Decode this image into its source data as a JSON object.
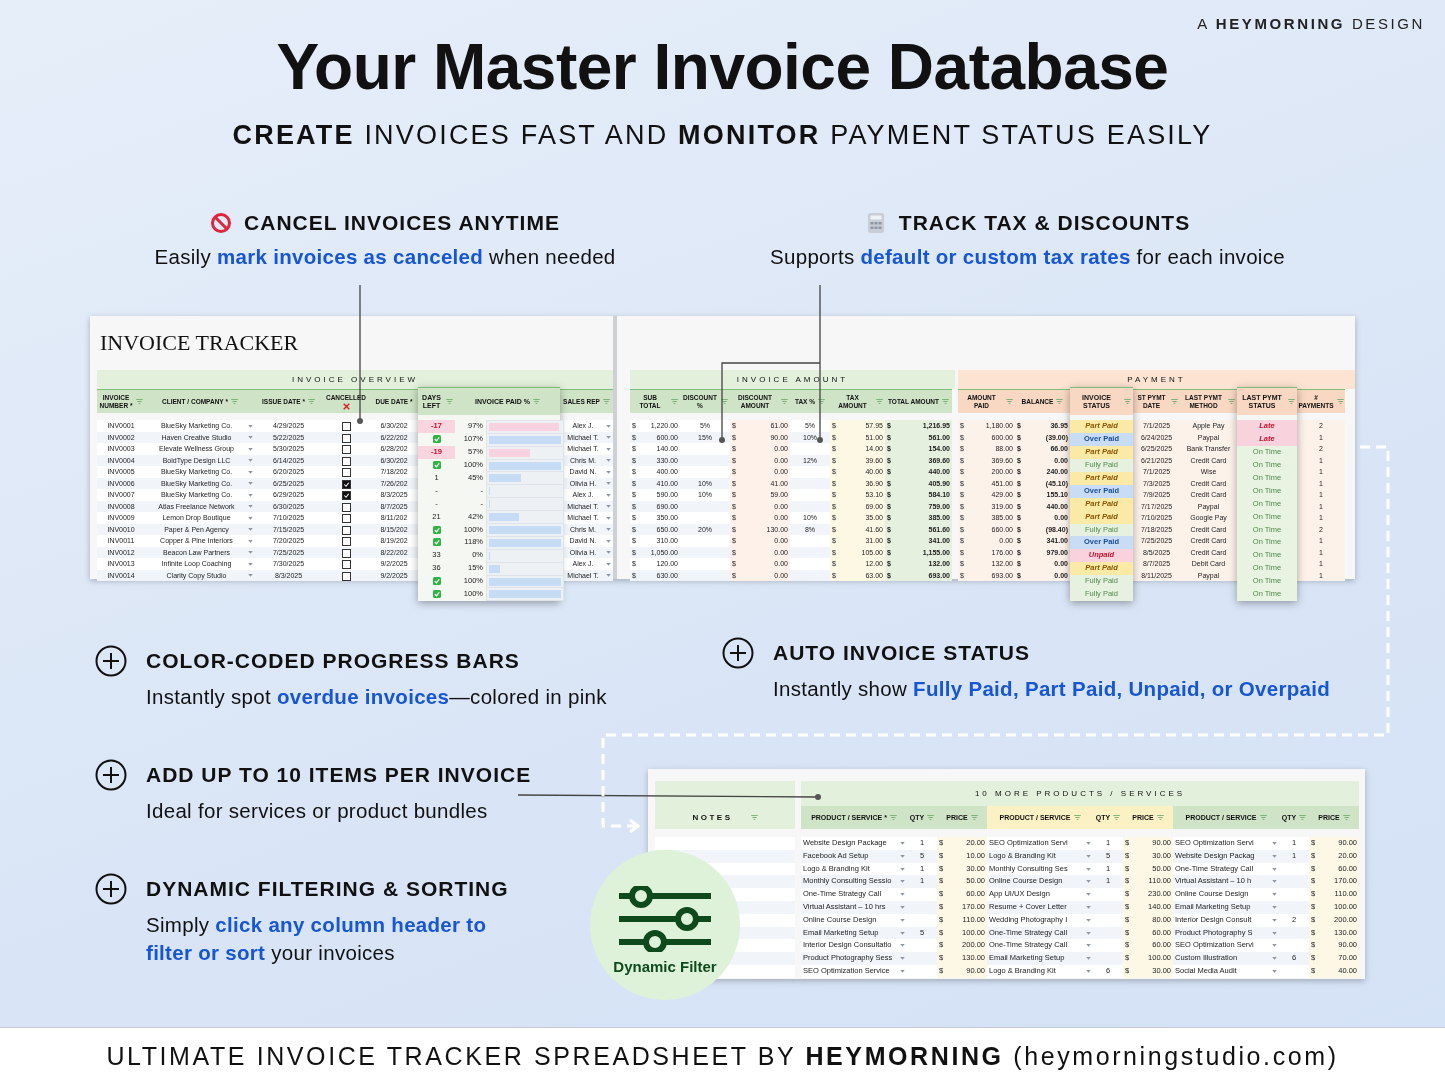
{
  "brand": "A **HEYMORNING** DESIGN",
  "title": "Your Master Invoice Database",
  "subtitle": "**CREATE** INVOICES FAST AND **MONITOR** PAYMENT STATUS EASILY",
  "top_features": [
    {
      "heading": "CANCEL INVOICES ANYTIME",
      "text": "Easily **mark invoices as canceled** when needed"
    },
    {
      "heading": "TRACK TAX & DISCOUNTS",
      "text": "Supports **default or custom tax rates** for each invoice"
    }
  ],
  "sheet_title": "INVOICE TRACKER",
  "overview": {
    "label": "INVOICE OVERVIEW",
    "headers": [
      "INVOICE NUMBER *",
      "CLIENT / COMPANY *",
      "ISSUE DATE *",
      "CANCELLED",
      "DUE DATE *",
      "DAYS LEFT",
      "INVOICE PAID %",
      "SALES REP"
    ],
    "rows": [
      {
        "number": "INV0001",
        "client": "BlueSky Marketing Co.",
        "issue_date": "4/29/2025",
        "cancelled": false,
        "due_date": "6/30/202",
        "days": {
          "kind": "overdue",
          "text": "-17"
        },
        "paid": "97%",
        "level": 0.97,
        "sales_rep": "Alex J."
      },
      {
        "number": "INV0002",
        "client": "Haven Creative Studio",
        "issue_date": "5/22/2025",
        "cancelled": false,
        "due_date": "6/22/202",
        "days": {
          "kind": "paid"
        },
        "paid": "107%",
        "level": 1,
        "sales_rep": "Michael T."
      },
      {
        "number": "INV0003",
        "client": "Elevate Wellness Group",
        "issue_date": "5/30/2025",
        "cancelled": false,
        "due_date": "6/28/202",
        "days": {
          "kind": "overdue",
          "text": "-19"
        },
        "paid": "57%",
        "level": 0.57,
        "sales_rep": "Michael T."
      },
      {
        "number": "INV0004",
        "client": "BoldType Design LLC",
        "issue_date": "6/14/2025",
        "cancelled": false,
        "due_date": "6/30/202",
        "days": {
          "kind": "paid"
        },
        "paid": "100%",
        "level": 1,
        "sales_rep": "Chris M."
      },
      {
        "number": "INV0005",
        "client": "BlueSky Marketing Co.",
        "issue_date": "6/20/2025",
        "cancelled": false,
        "due_date": "7/18/202",
        "days": {
          "kind": "plain",
          "text": "1"
        },
        "paid": "45%",
        "level": 0.45,
        "sales_rep": "David N."
      },
      {
        "number": "INV0006",
        "client": "BlueSky Marketing Co.",
        "issue_date": "6/25/2025",
        "cancelled": true,
        "due_date": "7/26/202",
        "days": {
          "kind": "plain",
          "text": "-"
        },
        "paid": "-",
        "level": 0,
        "sales_rep": "Olivia H."
      },
      {
        "number": "INV0007",
        "client": "BlueSky Marketing Co.",
        "issue_date": "6/29/2025",
        "cancelled": true,
        "due_date": "8/3/2025",
        "days": {
          "kind": "plain",
          "text": "-"
        },
        "paid": "-",
        "level": 0,
        "sales_rep": "Alex J."
      },
      {
        "number": "INV0008",
        "client": "Atlas Freelance Network",
        "issue_date": "6/30/2025",
        "cancelled": false,
        "due_date": "8/7/2025",
        "days": {
          "kind": "plain",
          "text": "21"
        },
        "paid": "42%",
        "level": 0.42,
        "sales_rep": "Michael T."
      },
      {
        "number": "INV0009",
        "client": "Lemon Drop Boutique",
        "issue_date": "7/10/2025",
        "cancelled": false,
        "due_date": "8/11/202",
        "days": {
          "kind": "paid"
        },
        "paid": "100%",
        "level": 1,
        "sales_rep": "Michael T."
      },
      {
        "number": "INV0010",
        "client": "Paper & Pen Agency",
        "issue_date": "7/15/2025",
        "cancelled": false,
        "due_date": "8/15/202",
        "days": {
          "kind": "paid"
        },
        "paid": "118%",
        "level": 1,
        "sales_rep": "Chris M."
      },
      {
        "number": "INV0011",
        "client": "Copper & Pine Interiors",
        "issue_date": "7/20/2025",
        "cancelled": false,
        "due_date": "8/19/202",
        "days": {
          "kind": "plain",
          "text": "33"
        },
        "paid": "0%",
        "level": 0,
        "sales_rep": "David N."
      },
      {
        "number": "INV0012",
        "client": "Beacon Law Partners",
        "issue_date": "7/25/2025",
        "cancelled": false,
        "due_date": "8/22/202",
        "days": {
          "kind": "plain",
          "text": "36"
        },
        "paid": "15%",
        "level": 0.15,
        "sales_rep": "Olivia H."
      },
      {
        "number": "INV0013",
        "client": "Infinite Loop Coaching",
        "issue_date": "7/30/2025",
        "cancelled": false,
        "due_date": "9/2/2025",
        "days": {
          "kind": "paid"
        },
        "paid": "100%",
        "level": 1,
        "sales_rep": "Alex J."
      },
      {
        "number": "INV0014",
        "client": "Clarity Copy Studio",
        "issue_date": "8/3/2025",
        "cancelled": false,
        "due_date": "9/2/2025",
        "days": {
          "kind": "paid"
        },
        "paid": "100%",
        "level": 1,
        "sales_rep": "Michael T."
      }
    ]
  },
  "amounts": {
    "label": "INVOICE AMOUNT",
    "headers": [
      "SUB TOTAL",
      "DISCOUNT %",
      "DISCOUNT AMOUNT",
      "TAX %",
      "TAX AMOUNT",
      "TOTAL AMOUNT"
    ],
    "rows": [
      {
        "sub_total": "$ 1,220.00",
        "discount_pct": "5%",
        "discount_amount": "$ 61.00",
        "tax_pct": "5%",
        "tax_amount": "$ 57.95",
        "total_amount": "$ 1,216.95"
      },
      {
        "sub_total": "$ 600.00",
        "discount_pct": "15%",
        "discount_amount": "$ 90.00",
        "tax_pct": "10%",
        "tax_amount": "$ 51.00",
        "total_amount": "$ 561.00"
      },
      {
        "sub_total": "$ 140.00",
        "discount_amount": "$ 0.00",
        "tax_amount": "$ 14.00",
        "total_amount": "$ 154.00"
      },
      {
        "sub_total": "$ 330.00",
        "discount_amount": "$ 0.00",
        "tax_pct": "12%",
        "tax_amount": "$ 39.60",
        "total_amount": "$ 369.60"
      },
      {
        "sub_total": "$ 400.00",
        "discount_amount": "$ 0.00",
        "tax_amount": "$ 40.00",
        "total_amount": "$ 440.00"
      },
      {
        "sub_total": "$ 410.00",
        "discount_pct": "10%",
        "discount_amount": "$ 41.00",
        "tax_amount": "$ 36.90",
        "total_amount": "$ 405.90"
      },
      {
        "sub_total": "$ 590.00",
        "discount_pct": "10%",
        "discount_amount": "$ 59.00",
        "tax_amount": "$ 53.10",
        "total_amount": "$ 584.10"
      },
      {
        "sub_total": "$ 690.00",
        "discount_amount": "$ 0.00",
        "tax_amount": "$ 69.00",
        "total_amount": "$ 759.00"
      },
      {
        "sub_total": "$ 350.00",
        "discount_amount": "$ 0.00",
        "tax_pct": "10%",
        "tax_amount": "$ 35.00",
        "total_amount": "$ 385.00"
      },
      {
        "sub_total": "$ 650.00",
        "discount_pct": "20%",
        "discount_amount": "$ 130.00",
        "tax_pct": "8%",
        "tax_amount": "$ 41.60",
        "total_amount": "$ 561.60"
      },
      {
        "sub_total": "$ 310.00",
        "discount_amount": "$ 0.00",
        "tax_amount": "$ 31.00",
        "total_amount": "$ 341.00"
      },
      {
        "sub_total": "$ 1,050.00",
        "discount_amount": "$ 0.00",
        "tax_amount": "$ 105.00",
        "total_amount": "$ 1,155.00"
      },
      {
        "sub_total": "$ 120.00",
        "discount_amount": "$ 0.00",
        "tax_amount": "$ 12.00",
        "total_amount": "$ 132.00"
      },
      {
        "sub_total": "$ 630.00",
        "discount_amount": "$ 0.00",
        "tax_amount": "$ 63.00",
        "total_amount": "$ 693.00"
      }
    ]
  },
  "payment": {
    "label": "PAYMENT",
    "headers": [
      "AMOUNT PAID",
      "BALANCE",
      "INVOICE STATUS",
      "ST PYMT DATE",
      "LAST PYMT METHOD",
      "LAST PYMT STATUS",
      "# PAYMENTS"
    ],
    "rows": [
      {
        "amount_paid": "$ 1,180.00",
        "balance": "$ 36.95",
        "status": {
          "kind": "part",
          "text": "Part Paid"
        },
        "last_date": "7/1/2025",
        "method": "Apple Pay",
        "last_status": {
          "kind": "late",
          "text": "Late"
        },
        "payments": "2"
      },
      {
        "amount_paid": "$ 600.00",
        "balance": "$ (39.00)",
        "status": {
          "kind": "over",
          "text": "Over Paid"
        },
        "last_date": "6/24/2025",
        "method": "Paypal",
        "last_status": {
          "kind": "late",
          "text": "Late"
        },
        "payments": "1"
      },
      {
        "amount_paid": "$ 88.00",
        "balance": "$ 66.00",
        "status": {
          "kind": "part",
          "text": "Part Paid"
        },
        "last_date": "6/25/2025",
        "method": "Bank Transfer",
        "last_status": {
          "kind": "ontime",
          "text": "On Time"
        },
        "payments": "2"
      },
      {
        "amount_paid": "$ 369.60",
        "balance": "$ 0.00",
        "status": {
          "kind": "fully",
          "text": "Fully Paid"
        },
        "last_date": "6/21/2025",
        "method": "Credit Card",
        "last_status": {
          "kind": "ontime",
          "text": "On Time"
        },
        "payments": "1"
      },
      {
        "amount_paid": "$ 200.00",
        "balance": "$ 240.00",
        "status": {
          "kind": "part",
          "text": "Part Paid"
        },
        "last_date": "7/1/2025",
        "method": "Wise",
        "last_status": {
          "kind": "ontime",
          "text": "On Time"
        },
        "payments": "1"
      },
      {
        "amount_paid": "$ 451.00",
        "balance": "$ (45.10)",
        "status": {
          "kind": "over",
          "text": "Over Paid"
        },
        "last_date": "7/3/2025",
        "method": "Credit Card",
        "last_status": {
          "kind": "ontime",
          "text": "On Time"
        },
        "payments": "1"
      },
      {
        "amount_paid": "$ 429.00",
        "balance": "$ 155.10",
        "status": {
          "kind": "part",
          "text": "Part Paid"
        },
        "last_date": "7/9/2025",
        "method": "Credit Card",
        "last_status": {
          "kind": "ontime",
          "text": "On Time"
        },
        "payments": "1"
      },
      {
        "amount_paid": "$ 319.00",
        "balance": "$ 440.00",
        "status": {
          "kind": "part",
          "text": "Part Paid"
        },
        "last_date": "7/17/2025",
        "method": "Paypal",
        "last_status": {
          "kind": "ontime",
          "text": "On Time"
        },
        "payments": "1"
      },
      {
        "amount_paid": "$ 385.00",
        "balance": "$ 0.00",
        "status": {
          "kind": "fully",
          "text": "Fully Paid"
        },
        "last_date": "7/10/2025",
        "method": "Google Pay",
        "last_status": {
          "kind": "ontime",
          "text": "On Time"
        },
        "payments": "1"
      },
      {
        "amount_paid": "$ 660.00",
        "balance": "$ (98.40)",
        "status": {
          "kind": "over",
          "text": "Over Paid"
        },
        "last_date": "7/18/2025",
        "method": "Credit Card",
        "last_status": {
          "kind": "ontime",
          "text": "On Time"
        },
        "payments": "2"
      },
      {
        "amount_paid": "$ 0.00",
        "balance": "$ 341.00",
        "status": {
          "kind": "unpaid",
          "text": "Unpaid"
        },
        "last_date": "7/25/2025",
        "method": "Credit Card",
        "last_status": {
          "kind": "ontime",
          "text": "On Time"
        },
        "payments": "1"
      },
      {
        "amount_paid": "$ 176.00",
        "balance": "$ 979.00",
        "status": {
          "kind": "part",
          "text": "Part Paid"
        },
        "last_date": "8/5/2025",
        "method": "Credit Card",
        "last_status": {
          "kind": "ontime",
          "text": "On Time"
        },
        "payments": "1"
      },
      {
        "amount_paid": "$ 132.00",
        "balance": "$ 0.00",
        "status": {
          "kind": "fully",
          "text": "Fully Paid"
        },
        "last_date": "8/7/2025",
        "method": "Debit Card",
        "last_status": {
          "kind": "ontime",
          "text": "On Time"
        },
        "payments": "1"
      },
      {
        "amount_paid": "$ 693.00",
        "balance": "$ 0.00",
        "status": {
          "kind": "fully",
          "text": "Fully Paid"
        },
        "last_date": "8/11/2025",
        "method": "Paypal",
        "last_status": {
          "kind": "ontime",
          "text": "On Time"
        },
        "payments": "1"
      }
    ]
  },
  "left_features": [
    {
      "heading": "COLOR-CODED PROGRESS BARS",
      "text": "Instantly spot **overdue invoices**—colored in pink"
    },
    {
      "heading": "ADD UP TO 10 ITEMS PER INVOICE",
      "text": "Ideal for services or product bundles"
    },
    {
      "heading": "DYNAMIC FILTERING & SORTING",
      "text": "Simply **click any column header to filter or sort** your invoices"
    }
  ],
  "right_feature": {
    "heading": "AUTO INVOICE STATUS",
    "text": "Instantly show **Fully Paid, Part Paid, Unpaid, or Overpaid**"
  },
  "products": {
    "notes_header": "NOTES",
    "label": "10 MORE PRODUCTS / SERVICES",
    "groups": [
      {
        "headers": [
          "PRODUCT / SERVICE *",
          "QTY",
          "PRICE"
        ]
      },
      {
        "headers": [
          "PRODUCT / SERVICE",
          "QTY",
          "PRICE"
        ]
      },
      {
        "headers": [
          "PRODUCT / SERVICE",
          "QTY",
          "PRICE"
        ]
      }
    ],
    "rows": [
      [
        {
          "product": "Website Design Package",
          "qty": "1",
          "price": "$ 20.00"
        },
        {
          "product": "SEO Optimization Servi",
          "qty": "1",
          "price": "$ 90.00"
        },
        {
          "product": "SEO Optimization Servi",
          "qty": "1",
          "price": "$ 90.00"
        }
      ],
      [
        {
          "product": "Facebook Ad Setup",
          "qty": "5",
          "price": "$ 10.00"
        },
        {
          "product": "Logo & Branding Kit",
          "qty": "5",
          "price": "$ 30.00"
        },
        {
          "product": "Website Design Packag",
          "qty": "1",
          "price": "$ 20.00"
        }
      ],
      [
        {
          "product": "Logo & Branding Kit",
          "qty": "1",
          "price": "$ 30.00"
        },
        {
          "product": "Monthly Consulting Ses",
          "qty": "1",
          "price": "$ 50.00"
        },
        {
          "product": "One-Time Strategy Call",
          "price": "$ 60.00"
        }
      ],
      [
        {
          "product": "Monthly Consulting Sessio",
          "qty": "1",
          "price": "$ 50.00"
        },
        {
          "product": "Online Course Design",
          "qty": "1",
          "price": "$ 110.00"
        },
        {
          "product": "Virtual Assistant – 10 h",
          "price": "$ 170.00"
        }
      ],
      [
        {
          "product": "One-Time Strategy Call",
          "price": "$ 60.00"
        },
        {
          "product": "App UI/UX Design",
          "price": "$ 230.00"
        },
        {
          "product": "Online Course Design",
          "price": "$ 110.00"
        }
      ],
      [
        {
          "product": "Virtual Assistant – 10 hrs",
          "price": "$ 170.00"
        },
        {
          "product": "Resume + Cover Letter",
          "price": "$ 140.00"
        },
        {
          "product": "Email Marketing Setup",
          "price": "$ 100.00"
        }
      ],
      [
        {
          "product": "Online Course Design",
          "price": "$ 110.00"
        },
        {
          "product": "Wedding Photography I",
          "price": "$ 80.00"
        },
        {
          "product": "Interior Design Consult",
          "qty": "2",
          "price": "$ 200.00"
        }
      ],
      [
        {
          "product": "Email Marketing Setup",
          "qty": "5",
          "price": "$ 100.00"
        },
        {
          "product": "One-Time Strategy Call",
          "price": "$ 60.00"
        },
        {
          "product": "Product Photography S",
          "price": "$ 130.00"
        }
      ],
      [
        {
          "product": "Interior Design Consultatio",
          "price": "$ 200.00"
        },
        {
          "product": "One-Time Strategy Call",
          "price": "$ 60.00"
        },
        {
          "product": "SEO Optimization Servi",
          "price": "$ 90.00"
        }
      ],
      [
        {
          "product": "Product Photography Sess",
          "price": "$ 130.00"
        },
        {
          "product": "Email Marketing Setup",
          "price": "$ 100.00"
        },
        {
          "product": "Custom Illustration",
          "qty": "6",
          "price": "$ 70.00"
        }
      ],
      [
        {
          "product": "SEO Optimization Service",
          "price": "$ 90.00"
        },
        {
          "product": "Logo & Branding Kit",
          "qty": "6",
          "price": "$ 30.00"
        },
        {
          "product": "Social Media Audit",
          "price": "$ 40.00"
        }
      ]
    ]
  },
  "badge": "Dynamic Filter",
  "footer": "ULTIMATE INVOICE TRACKER SPREADSHEET BY **HEYMORNING** (heymorningstudio.com)"
}
